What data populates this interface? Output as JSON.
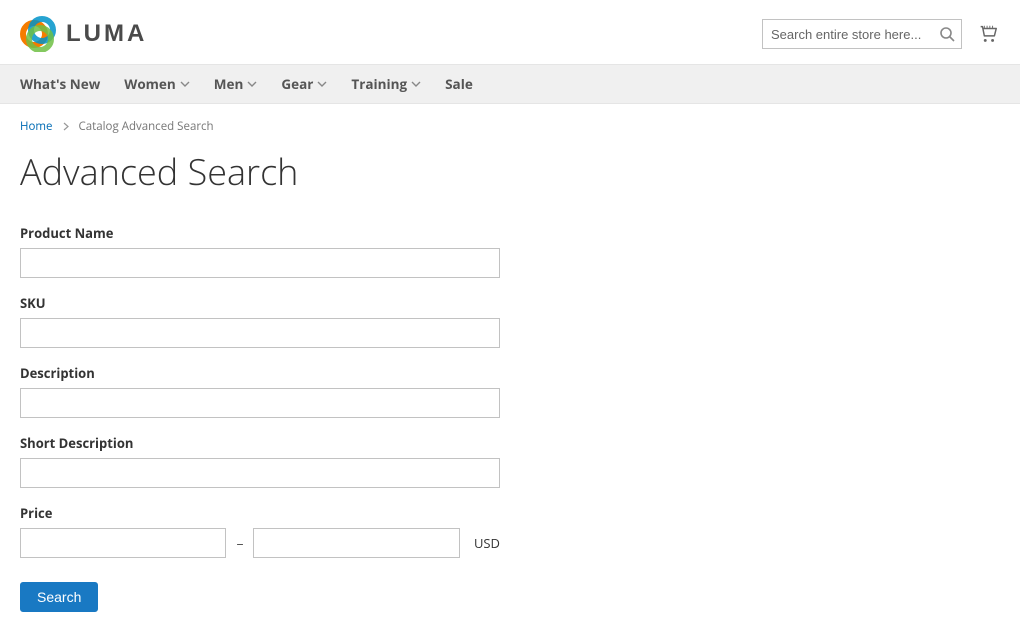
{
  "header": {
    "brand_text": "LUMA",
    "search_placeholder": "Search entire store here..."
  },
  "nav": {
    "items": [
      {
        "label": "What's New",
        "has_submenu": false
      },
      {
        "label": "Women",
        "has_submenu": true
      },
      {
        "label": "Men",
        "has_submenu": true
      },
      {
        "label": "Gear",
        "has_submenu": true
      },
      {
        "label": "Training",
        "has_submenu": true
      },
      {
        "label": "Sale",
        "has_submenu": false
      }
    ]
  },
  "breadcrumbs": {
    "home": "Home",
    "current": "Catalog Advanced Search"
  },
  "page_title": "Advanced Search",
  "form": {
    "product_name": {
      "label": "Product Name",
      "value": ""
    },
    "sku": {
      "label": "SKU",
      "value": ""
    },
    "description": {
      "label": "Description",
      "value": ""
    },
    "short_desc": {
      "label": "Short Description",
      "value": ""
    },
    "price": {
      "label": "Price",
      "from": "",
      "to": "",
      "separator": "–",
      "currency": "USD"
    },
    "submit_label": "Search"
  }
}
